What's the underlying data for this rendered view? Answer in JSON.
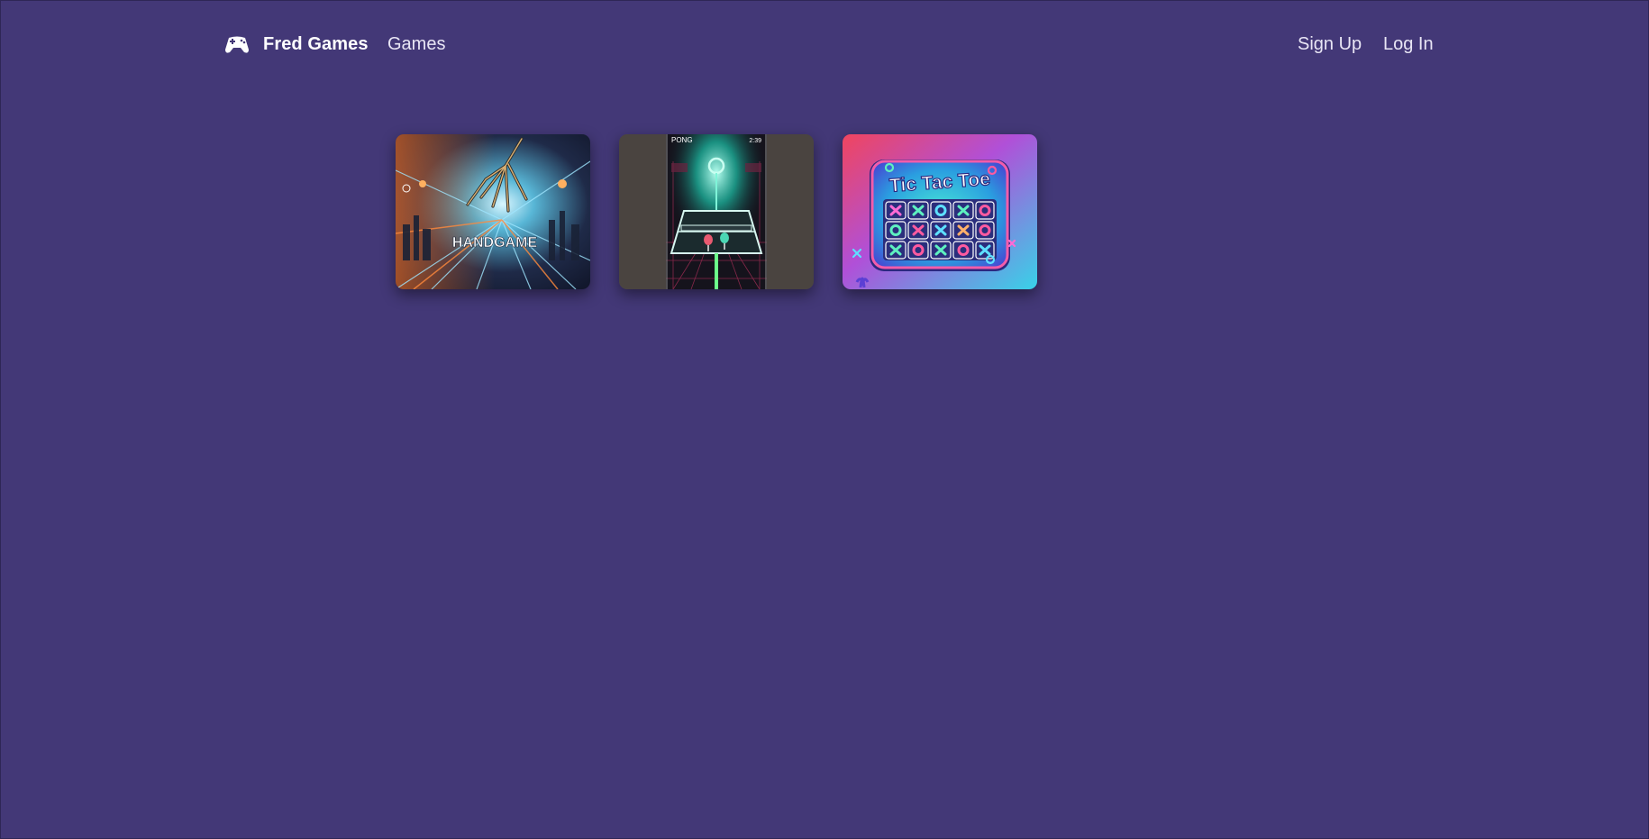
{
  "header": {
    "brand": {
      "name": "Fred Games",
      "icon": "gamepad-icon"
    },
    "nav_games_label": "Games",
    "signup_label": "Sign Up",
    "login_label": "Log In"
  },
  "games": [
    {
      "title_art": "HANDGAME"
    },
    {
      "title_art": "PONG",
      "score_art": "2:39"
    },
    {
      "title_art": "Tic Tac Toe"
    }
  ],
  "colors": {
    "background": "#433877",
    "text": "#ffffff"
  }
}
